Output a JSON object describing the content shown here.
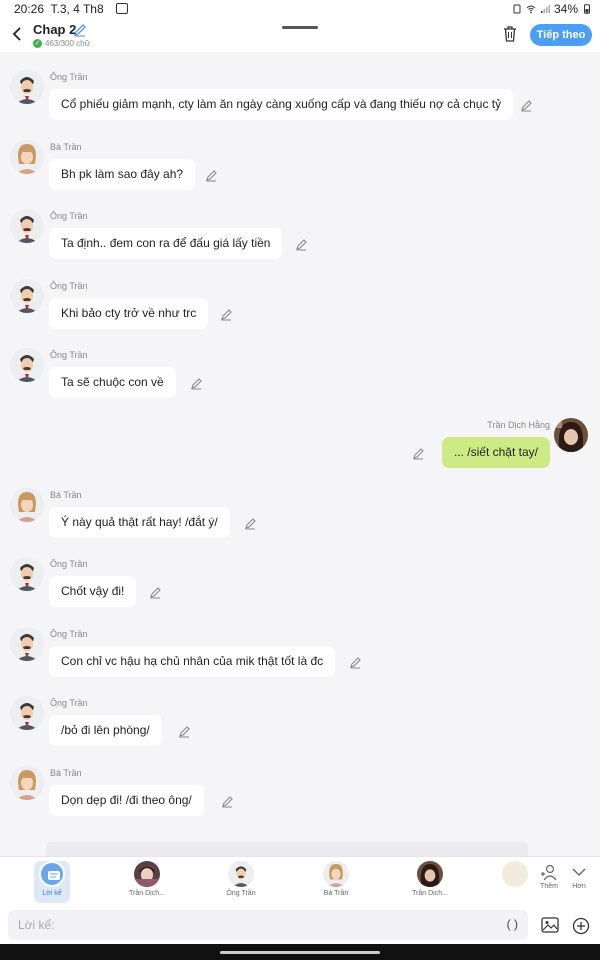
{
  "status": {
    "time": "20:26",
    "date": "T.3, 4 Th8",
    "battery": "34%"
  },
  "header": {
    "title": "Chap 2",
    "word_count": "463/300 chữ",
    "next_label": "Tiếp theo"
  },
  "messages": [
    {
      "speaker": "Ông Trần",
      "text": "Cổ phiếu giảm mạnh, cty làm ăn ngày càng xuống cấp và đang thiếu nợ cả chục tỷ",
      "side": "left",
      "avatar": "ong-tran"
    },
    {
      "speaker": "Bà Trần",
      "text": "Bh pk làm sao đây ah?",
      "side": "left",
      "avatar": "ba-tran"
    },
    {
      "speaker": "Ông Trần",
      "text": "Ta định.. đem con ra để đấu giá lấy tiền",
      "side": "left",
      "avatar": "ong-tran"
    },
    {
      "speaker": "Ông Trần",
      "text": "Khi bảo cty trở về như trc",
      "side": "left",
      "avatar": "ong-tran"
    },
    {
      "speaker": "Ông Trần",
      "text": "Ta sẽ chuộc con về",
      "side": "left",
      "avatar": "ong-tran"
    },
    {
      "speaker": "Trần Dịch Hằng",
      "text": "... /siết chặt tay/",
      "side": "right",
      "avatar": "tran-dich-hang"
    },
    {
      "speaker": "Bà Trần",
      "text": "Ý này quả thật rất hay! /đắt ý/",
      "side": "left",
      "avatar": "ba-tran"
    },
    {
      "speaker": "Ông Trần",
      "text": "Chốt vậy đi!",
      "side": "left",
      "avatar": "ong-tran"
    },
    {
      "speaker": "Ông Trần",
      "text": "Con chỉ vc hậu hạ chủ nhân của mik thật tốt là đc",
      "side": "left",
      "avatar": "ong-tran"
    },
    {
      "speaker": "Ông Trần",
      "text": "/bỏ đi lên phòng/",
      "side": "left",
      "avatar": "ong-tran"
    },
    {
      "speaker": "Bà Trần",
      "text": "Dọn dẹp đi! /đi theo ông/",
      "side": "left",
      "avatar": "ba-tran"
    }
  ],
  "characters": [
    {
      "label": "Lời kể",
      "avatar": "narrator"
    },
    {
      "label": "Trần Dịch...",
      "avatar": "tran-dich-1"
    },
    {
      "label": "Ông Trần",
      "avatar": "ong-tran"
    },
    {
      "label": "Bà Trần",
      "avatar": "ba-tran"
    },
    {
      "label": "Trần Dịch...",
      "avatar": "tran-dich-hang"
    }
  ],
  "side_buttons": {
    "add_label": "Thêm",
    "more_label": "Hơn"
  },
  "input": {
    "placeholder": "Lời kể:",
    "paren_label": "( )"
  },
  "colors": {
    "accent": "#4a9ff5",
    "right_bubble": "#cdeb84",
    "chat_bg": "#f5f5f7"
  }
}
